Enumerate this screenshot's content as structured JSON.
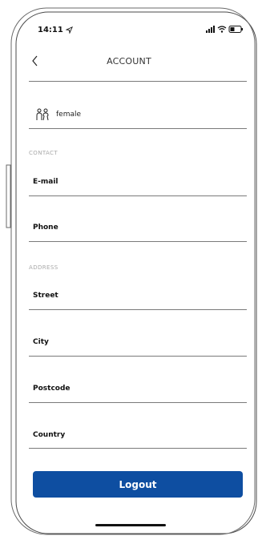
{
  "status_bar": {
    "time": "14:11",
    "location_icon": "location-arrow-icon",
    "signal_icon": "signal-icon",
    "wifi_icon": "wifi-icon",
    "battery_icon": "battery-icon"
  },
  "header": {
    "back_icon": "chevron-left-icon",
    "title": "ACCOUNT"
  },
  "gender": {
    "icon": "gender-icon",
    "value": "female"
  },
  "sections": {
    "contact": "CONTACT",
    "address": "ADDRESS"
  },
  "fields": {
    "email": "E-mail",
    "phone": "Phone",
    "street": "Street",
    "city": "City",
    "postcode": "Postcode",
    "country": "Country"
  },
  "logout": {
    "label": "Logout",
    "color": "#0e4ea1"
  }
}
